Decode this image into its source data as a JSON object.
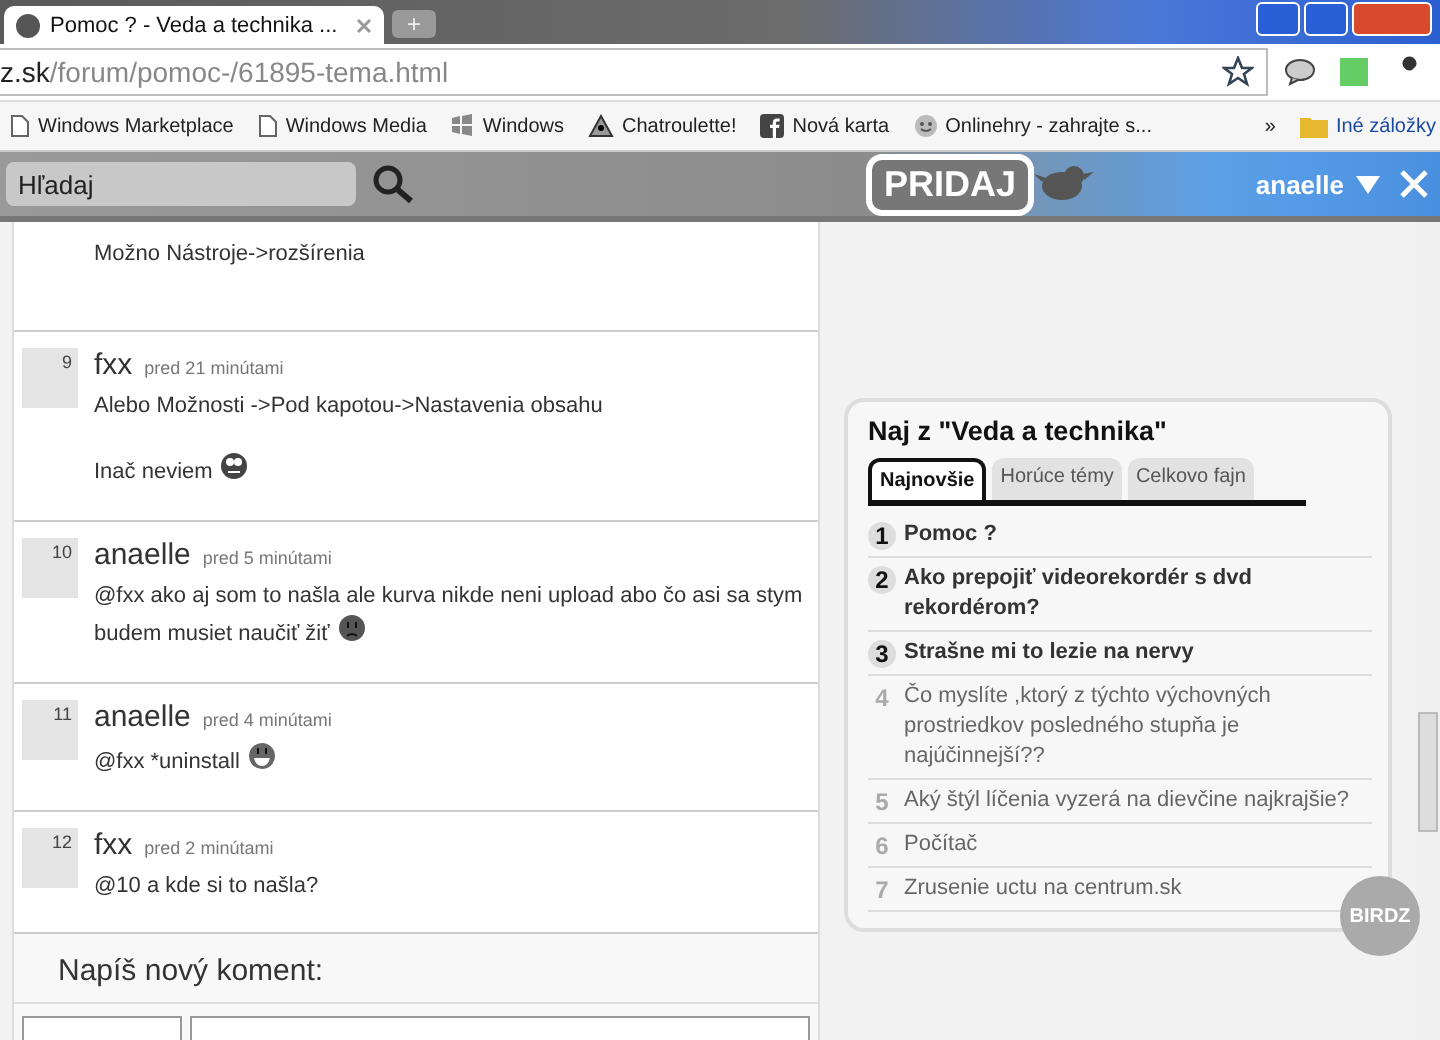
{
  "browser": {
    "tab_title": "Pomoc ? - Veda a technika ...",
    "new_tab": "+",
    "url_host": "z.sk",
    "url_path": "/forum/pomoc-/61895-tema.html",
    "bookmarks": [
      {
        "label": "Windows Marketplace",
        "kind": "page"
      },
      {
        "label": "Windows Media",
        "kind": "page"
      },
      {
        "label": "Windows",
        "kind": "windows"
      },
      {
        "label": "Chatroulette!",
        "kind": "eye"
      },
      {
        "label": "Nová karta",
        "kind": "facebook"
      },
      {
        "label": "Onlinehry - zahrajte s...",
        "kind": "smiley"
      }
    ],
    "more": "»",
    "other_bookmarks": "Iné záložky"
  },
  "site_header": {
    "search": {
      "placeholder": "Hľadaj"
    },
    "logo": "PRIDAJ",
    "user": "anaelle"
  },
  "posts": [
    {
      "lines": [
        "Možno Nástroje->rozšírenia"
      ]
    },
    {
      "number": "9",
      "author": "fxx",
      "time": "pred 21 minútami",
      "lines": [
        "Alebo Možnosti ->Pod kapotou->Nastavenia obsahu",
        "Inač neviem"
      ],
      "emoticon": {
        "kind": "crazy"
      }
    },
    {
      "number": "10",
      "author": "anaelle",
      "time": "pred 5 minútami",
      "lines": [
        "@fxx ako aj som to našla ale kurva nikde neni upload abo čo asi sa stym budem musiet naučiť žiť"
      ],
      "emoticon": {
        "kind": "sad"
      }
    },
    {
      "number": "11",
      "author": "anaelle",
      "time": "pred 4 minútami",
      "lines": [
        "@fxx *uninstall"
      ],
      "emoticon": {
        "kind": "grin"
      }
    },
    {
      "number": "12",
      "author": "fxx",
      "time": "pred 2 minútami",
      "lines": [
        "@10 a kde si to našla?"
      ]
    }
  ],
  "new_comment": {
    "heading": "Napíš nový koment:"
  },
  "sidebar": {
    "title": "Naj z \"Veda a technika\"",
    "tabs": [
      {
        "label": "Najnovšie",
        "selected": true
      },
      {
        "label": "Horúce témy",
        "selected": false
      },
      {
        "label": "Celkovo fajn",
        "selected": false
      }
    ],
    "items": [
      {
        "rank": "1",
        "title": "Pomoc ?",
        "top": true
      },
      {
        "rank": "2",
        "title": "Ako prepojiť videorekordér s dvd rekordérom?",
        "top": true
      },
      {
        "rank": "3",
        "title": "Strašne mi to lezie na nervy",
        "top": true
      },
      {
        "rank": "4",
        "title": "Čo myslíte ,ktorý z týchto výchovných prostriedkov posledného stupňa je najúčinnejší??",
        "top": false
      },
      {
        "rank": "5",
        "title": "Aký štýl líčenia vyzerá na dievčine najkrajšie?",
        "top": false
      },
      {
        "rank": "6",
        "title": "Počítač",
        "top": false
      },
      {
        "rank": "7",
        "title": "Zrusenie uctu na centrum.sk",
        "top": false
      }
    ],
    "badge": "BIRDZ"
  }
}
